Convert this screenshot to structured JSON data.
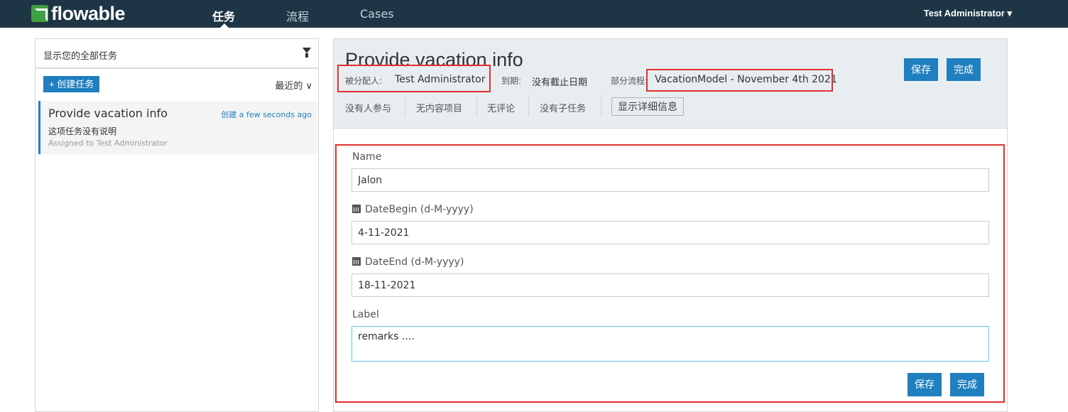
{
  "app": {
    "logo_text": "flowable",
    "brand_color": "#3fa043",
    "nav_bg": "#1d3545",
    "accent": "#1f7fbf"
  },
  "nav": {
    "items": [
      {
        "label": "任务",
        "active": true
      },
      {
        "label": "流程",
        "active": false
      },
      {
        "label": "Cases",
        "active": false
      }
    ],
    "user": "Test Administrator ▾"
  },
  "task_list": {
    "filter_label": "显示您的全部任务",
    "create_button": "+ 创建任务",
    "sort_label": "最近的 ∨",
    "items": [
      {
        "title": "Provide vacation info",
        "created": "创建 a few seconds ago",
        "description": "这项任务没有说明",
        "assigned": "Assigned to Test Administrator"
      }
    ]
  },
  "task_detail": {
    "title": "Provide vacation info",
    "assignee_label": "被分配人:",
    "assignee_value": "Test Administrator",
    "due_label": "到期:",
    "due_value": "没有截止日期",
    "process_label": "部分流程:",
    "process_value": "VacationModel - November 4th 2021",
    "save_button": "保存",
    "complete_button": "完成",
    "stats": [
      "没有人参与",
      "无内容项目",
      "无评论",
      "没有子任务"
    ],
    "details_button": "显示详细信息"
  },
  "form": {
    "fields": [
      {
        "label": "Name",
        "value": "Jalon",
        "calendar": false
      },
      {
        "label": "DateBegin (d-M-yyyy)",
        "value": "4-11-2021",
        "calendar": true
      },
      {
        "label": "DateEnd (d-M-yyyy)",
        "value": "18-11-2021",
        "calendar": true
      },
      {
        "label": "Label",
        "value": "remarks ....",
        "calendar": false
      }
    ],
    "save_button": "保存",
    "complete_button": "完成"
  }
}
